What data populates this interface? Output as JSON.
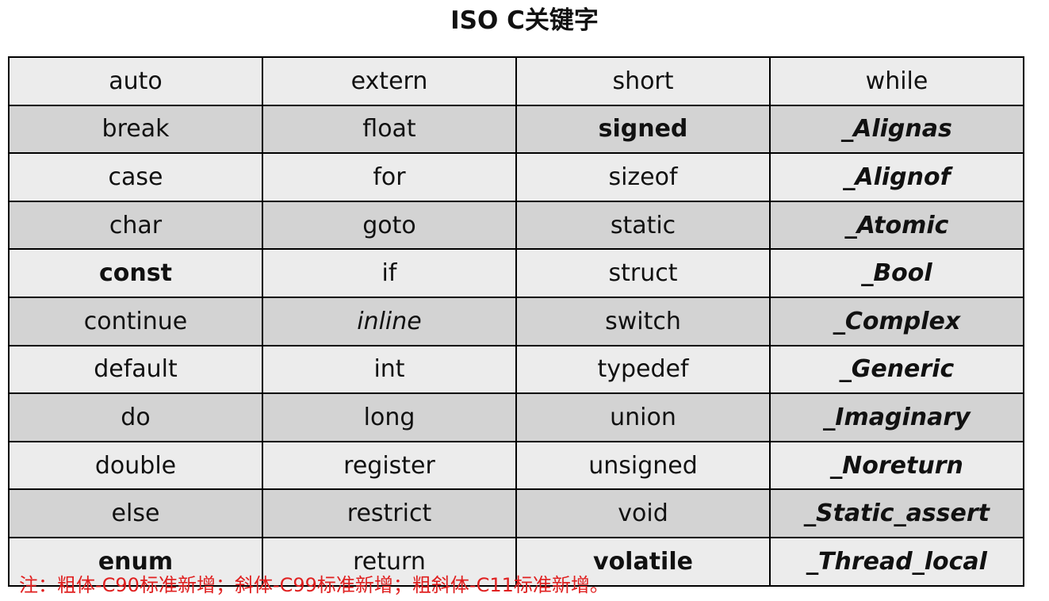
{
  "title": "ISO C关键字",
  "colors": {
    "row_light": "#ececec",
    "row_dark": "#d3d3d3",
    "border": "#000000",
    "note_text": "#e02020"
  },
  "table": {
    "rows": [
      [
        {
          "text": "auto",
          "style": "normal"
        },
        {
          "text": "extern",
          "style": "normal"
        },
        {
          "text": "short",
          "style": "normal"
        },
        {
          "text": "while",
          "style": "normal"
        }
      ],
      [
        {
          "text": "break",
          "style": "normal"
        },
        {
          "text": "float",
          "style": "normal"
        },
        {
          "text": "signed",
          "style": "bold"
        },
        {
          "text": "_Alignas",
          "style": "bold-italic"
        }
      ],
      [
        {
          "text": "case",
          "style": "normal"
        },
        {
          "text": "for",
          "style": "normal"
        },
        {
          "text": "sizeof",
          "style": "normal"
        },
        {
          "text": "_Alignof",
          "style": "bold-italic"
        }
      ],
      [
        {
          "text": "char",
          "style": "normal"
        },
        {
          "text": "goto",
          "style": "normal"
        },
        {
          "text": "static",
          "style": "normal"
        },
        {
          "text": "_Atomic",
          "style": "bold-italic"
        }
      ],
      [
        {
          "text": "const",
          "style": "bold"
        },
        {
          "text": "if",
          "style": "normal"
        },
        {
          "text": "struct",
          "style": "normal"
        },
        {
          "text": "_Bool",
          "style": "bold-italic"
        }
      ],
      [
        {
          "text": "continue",
          "style": "normal"
        },
        {
          "text": "inline",
          "style": "italic"
        },
        {
          "text": "switch",
          "style": "normal"
        },
        {
          "text": "_Complex",
          "style": "bold-italic"
        }
      ],
      [
        {
          "text": "default",
          "style": "normal"
        },
        {
          "text": "int",
          "style": "normal"
        },
        {
          "text": "typedef",
          "style": "normal"
        },
        {
          "text": "_Generic",
          "style": "bold-italic"
        }
      ],
      [
        {
          "text": "do",
          "style": "normal"
        },
        {
          "text": "long",
          "style": "normal"
        },
        {
          "text": "union",
          "style": "normal"
        },
        {
          "text": "_Imaginary",
          "style": "bold-italic"
        }
      ],
      [
        {
          "text": "double",
          "style": "normal"
        },
        {
          "text": "register",
          "style": "normal"
        },
        {
          "text": "unsigned",
          "style": "normal"
        },
        {
          "text": "_Noreturn",
          "style": "bold-italic"
        }
      ],
      [
        {
          "text": "else",
          "style": "normal"
        },
        {
          "text": "restrict",
          "style": "normal"
        },
        {
          "text": "void",
          "style": "normal"
        },
        {
          "text": "_Static_assert",
          "style": "bold-italic"
        }
      ],
      [
        {
          "text": "enum",
          "style": "bold"
        },
        {
          "text": "return",
          "style": "normal"
        },
        {
          "text": "volatile",
          "style": "bold"
        },
        {
          "text": "_Thread_local",
          "style": "bold-italic"
        }
      ]
    ]
  },
  "note": "注：粗体-C90标准新增；斜体-C99标准新增；粗斜体-C11标准新增。"
}
